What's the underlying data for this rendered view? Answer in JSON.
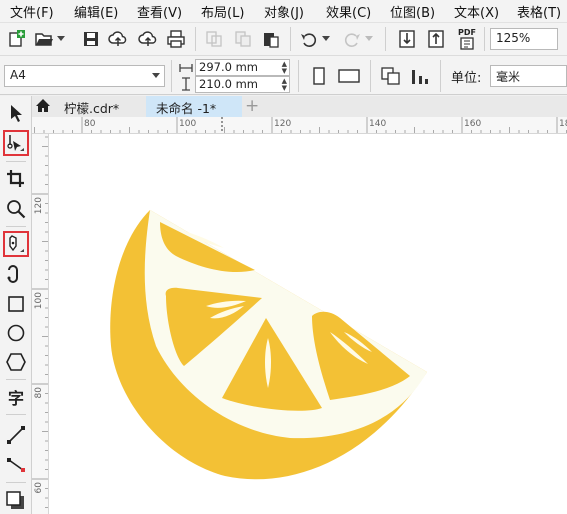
{
  "menu": {
    "items": [
      "文件(F)",
      "编辑(E)",
      "查看(V)",
      "布局(L)",
      "对象(J)",
      "效果(C)",
      "位图(B)",
      "文本(X)",
      "表格(T)"
    ]
  },
  "toolbar": {
    "icons": [
      "new-document-icon",
      "open-folder-icon",
      "save-icon",
      "cloud-upload-icon",
      "cloud-share-icon",
      "print-icon",
      "cut-icon",
      "copy-icon",
      "paste-icon",
      "undo-icon",
      "redo-icon",
      "import-icon",
      "export-icon",
      "pdf-icon"
    ],
    "pdf_label": "PDF",
    "zoom": "125%"
  },
  "property_bar": {
    "page_size": "A4",
    "width": "297.0 mm",
    "height": "210.0 mm",
    "units_label": "单位:",
    "units_value": "毫米"
  },
  "toolbox": {
    "tools": [
      "pick-tool-icon",
      "shape-tool-icon",
      "crop-tool-icon",
      "zoom-tool-icon",
      "pen-tool-icon",
      "artistic-media-icon",
      "rectangle-tool-icon",
      "ellipse-tool-icon",
      "polygon-tool-icon",
      "text-tool-icon",
      "line-tool-icon",
      "connector-tool-icon",
      "shadow-tool-icon"
    ],
    "text_tool_glyph": "字"
  },
  "tabs": {
    "welcome_icon": "home-icon",
    "items": [
      "柠檬.cdr*",
      "未命名 -1*"
    ],
    "add": "+"
  },
  "rulers": {
    "horizontal_labels": [
      "80",
      "100",
      "120",
      "140",
      "160",
      "180"
    ],
    "vertical_labels": [
      "120",
      "100",
      "80",
      "60"
    ]
  },
  "colors": {
    "lemon_rind": "#f3c135",
    "lemon_pith": "#fbfbee",
    "lemon_segment": "#f3c135",
    "highlight_border": "#e0343a",
    "selected_tab": "#cfe6f8"
  }
}
